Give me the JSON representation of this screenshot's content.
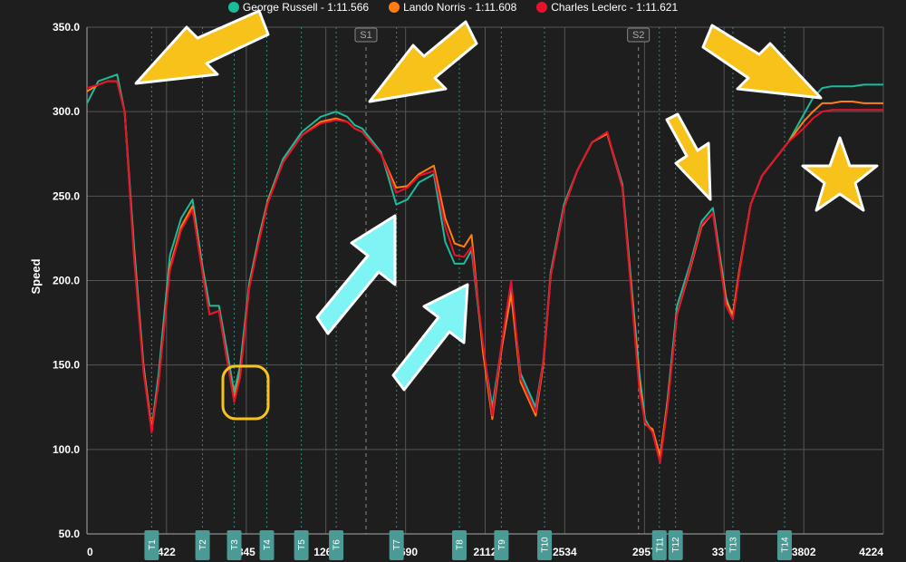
{
  "chart_data": {
    "type": "line",
    "title": "",
    "xlabel": "",
    "ylabel": "Speed",
    "xlim": [
      0,
      4224
    ],
    "ylim": [
      50,
      350
    ],
    "grid": true,
    "legend_position": "top-center",
    "y_ticks": [
      "350.0",
      "300.0",
      "250.0",
      "200.0",
      "150.0",
      "100.0",
      "50.0"
    ],
    "x_ticks": [
      {
        "label": "0",
        "value": 0
      },
      {
        "label": "422",
        "value": 422
      },
      {
        "label": "845",
        "value": 845
      },
      {
        "label": "1267",
        "value": 1267
      },
      {
        "label": "1690",
        "value": 1690
      },
      {
        "label": "2112",
        "value": 2112
      },
      {
        "label": "2534",
        "value": 2534
      },
      {
        "label": "2957",
        "value": 2957
      },
      {
        "label": "3379",
        "value": 3379
      },
      {
        "label": "3802",
        "value": 3802
      },
      {
        "label": "4224",
        "value": 4224
      }
    ],
    "sectors": [
      {
        "label": "S1",
        "x": 1480
      },
      {
        "label": "S2",
        "x": 2925
      }
    ],
    "turns": [
      {
        "label": "T1",
        "x": 343
      },
      {
        "label": "T2",
        "x": 613
      },
      {
        "label": "T3",
        "x": 781
      },
      {
        "label": "T4",
        "x": 954
      },
      {
        "label": "T5",
        "x": 1137
      },
      {
        "label": "T6",
        "x": 1322
      },
      {
        "label": "T7",
        "x": 1642
      },
      {
        "label": "T8",
        "x": 1975
      },
      {
        "label": "T9",
        "x": 2198
      },
      {
        "label": "T10",
        "x": 2427
      },
      {
        "label": "T11",
        "x": 3036
      },
      {
        "label": "T12",
        "x": 3122
      },
      {
        "label": "T13",
        "x": 3426
      },
      {
        "label": "T14",
        "x": 3700
      }
    ],
    "series": [
      {
        "name": "George Russell - 1:11.566",
        "color": "#1abc9c",
        "x": [
          0,
          60,
          110,
          160,
          200,
          250,
          300,
          343,
          380,
          440,
          500,
          560,
          613,
          650,
          700,
          740,
          781,
          813,
          860,
          910,
          960,
          1040,
          1140,
          1240,
          1320,
          1380,
          1420,
          1460,
          1560,
          1640,
          1700,
          1760,
          1840,
          1900,
          1950,
          2000,
          2040,
          2100,
          2150,
          2200,
          2250,
          2300,
          2380,
          2420,
          2460,
          2530,
          2600,
          2680,
          2760,
          2840,
          2930,
          2960,
          3000,
          3040,
          3080,
          3130,
          3200,
          3260,
          3320,
          3390,
          3426,
          3460,
          3520,
          3580,
          3650,
          3720,
          3800,
          3850,
          3900,
          3950,
          4000,
          4060,
          4120,
          4224
        ],
        "y": [
          305,
          318,
          320,
          322,
          300,
          220,
          150,
          112,
          145,
          215,
          237,
          248,
          208,
          185,
          185,
          160,
          134,
          150,
          198,
          225,
          248,
          272,
          288,
          297,
          300,
          297,
          292,
          290,
          276,
          245,
          248,
          258,
          263,
          223,
          210,
          210,
          218,
          160,
          125,
          162,
          195,
          145,
          125,
          152,
          205,
          245,
          265,
          282,
          287,
          257,
          145,
          118,
          110,
          93,
          130,
          185,
          210,
          235,
          243,
          190,
          178,
          205,
          245,
          262,
          272,
          282,
          298,
          308,
          314,
          315,
          315,
          315,
          316,
          316
        ]
      },
      {
        "name": "Lando Norris - 1:11.608",
        "color": "#ff7f0e",
        "x": [
          0,
          60,
          110,
          160,
          200,
          250,
          300,
          343,
          380,
          440,
          500,
          560,
          613,
          650,
          700,
          740,
          781,
          813,
          860,
          910,
          960,
          1040,
          1140,
          1240,
          1320,
          1380,
          1420,
          1460,
          1560,
          1640,
          1700,
          1760,
          1840,
          1900,
          1950,
          2000,
          2040,
          2100,
          2150,
          2200,
          2250,
          2300,
          2380,
          2420,
          2460,
          2530,
          2600,
          2680,
          2760,
          2840,
          2930,
          2960,
          3000,
          3040,
          3080,
          3130,
          3200,
          3260,
          3320,
          3390,
          3426,
          3460,
          3520,
          3580,
          3650,
          3720,
          3800,
          3850,
          3900,
          3950,
          4000,
          4060,
          4120,
          4224
        ],
        "y": [
          312,
          316,
          318,
          318,
          300,
          215,
          148,
          112,
          140,
          208,
          232,
          244,
          205,
          180,
          182,
          155,
          130,
          145,
          196,
          223,
          247,
          270,
          286,
          294,
          296,
          294,
          290,
          288,
          275,
          255,
          256,
          263,
          268,
          237,
          222,
          220,
          227,
          158,
          118,
          160,
          192,
          140,
          120,
          150,
          203,
          243,
          265,
          282,
          287,
          255,
          140,
          115,
          112,
          96,
          128,
          180,
          207,
          232,
          240,
          188,
          180,
          206,
          245,
          262,
          272,
          282,
          294,
          300,
          305,
          305,
          306,
          306,
          305,
          305
        ]
      },
      {
        "name": "Charles Leclerc - 1:11.621",
        "color": "#e8112d",
        "x": [
          0,
          60,
          110,
          160,
          200,
          250,
          300,
          343,
          380,
          440,
          500,
          560,
          613,
          650,
          700,
          740,
          781,
          813,
          860,
          910,
          960,
          1040,
          1140,
          1240,
          1320,
          1380,
          1420,
          1460,
          1560,
          1640,
          1700,
          1760,
          1840,
          1900,
          1950,
          2000,
          2040,
          2100,
          2150,
          2200,
          2250,
          2300,
          2380,
          2420,
          2460,
          2530,
          2600,
          2680,
          2760,
          2840,
          2930,
          2960,
          3000,
          3040,
          3080,
          3130,
          3200,
          3260,
          3320,
          3390,
          3426,
          3460,
          3520,
          3580,
          3650,
          3720,
          3800,
          3850,
          3900,
          3950,
          4000,
          4060,
          4120,
          4224
        ],
        "y": [
          314,
          316,
          318,
          318,
          300,
          213,
          146,
          110,
          140,
          206,
          230,
          242,
          204,
          180,
          182,
          155,
          128,
          143,
          195,
          222,
          246,
          270,
          286,
          293,
          295,
          294,
          290,
          288,
          275,
          252,
          255,
          262,
          265,
          232,
          215,
          214,
          220,
          163,
          120,
          163,
          200,
          142,
          122,
          152,
          203,
          243,
          265,
          282,
          288,
          255,
          135,
          116,
          110,
          92,
          126,
          180,
          208,
          233,
          240,
          185,
          177,
          204,
          245,
          262,
          272,
          282,
          290,
          296,
          300,
          301,
          301,
          301,
          301,
          301
        ]
      }
    ]
  }
}
